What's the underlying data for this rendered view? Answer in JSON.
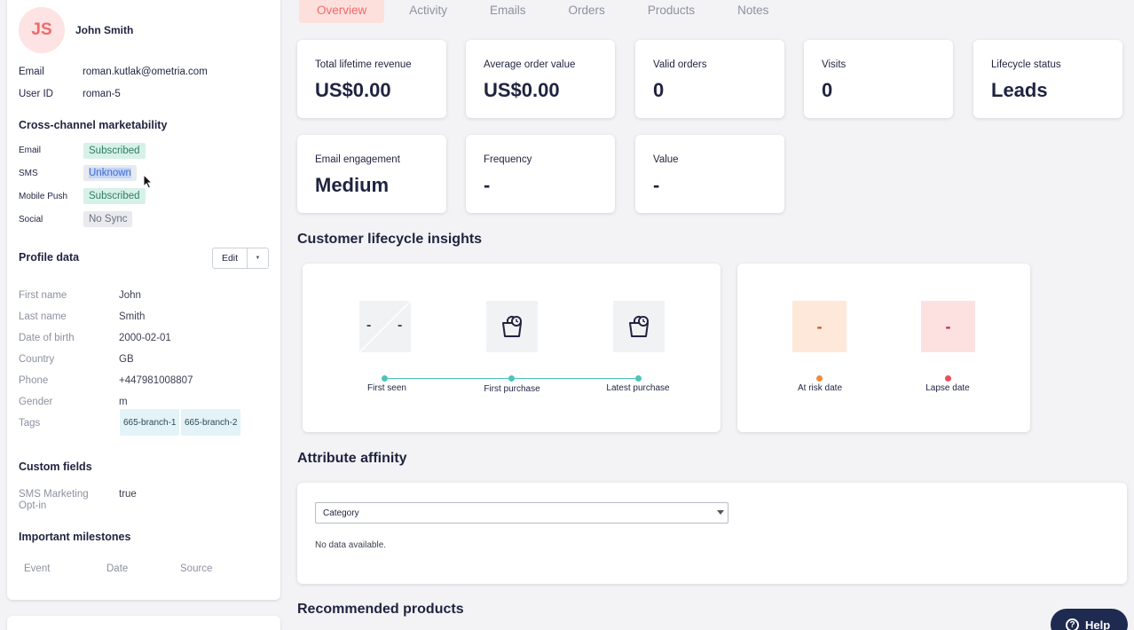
{
  "profile": {
    "initials": "JS",
    "name": "John Smith",
    "email_label": "Email",
    "email": "roman.kutlak@ometria.com",
    "userid_label": "User ID",
    "userid": "roman-5"
  },
  "marketability": {
    "title": "Cross-channel marketability",
    "channels": [
      {
        "label": "Email",
        "status": "Subscribed"
      },
      {
        "label": "SMS",
        "status": "Unknown"
      },
      {
        "label": "Mobile Push",
        "status": "Subscribed"
      },
      {
        "label": "Social",
        "status": "No Sync"
      }
    ]
  },
  "profile_data": {
    "title": "Profile data",
    "edit_label": "Edit",
    "fields": [
      {
        "label": "First name",
        "value": "John"
      },
      {
        "label": "Last name",
        "value": "Smith"
      },
      {
        "label": "Date of birth",
        "value": "2000-02-01"
      },
      {
        "label": "Country",
        "value": "GB"
      },
      {
        "label": "Phone",
        "value": "+447981008807"
      },
      {
        "label": "Gender",
        "value": "m"
      },
      {
        "label": "Tags",
        "value": ""
      }
    ],
    "tags": [
      "665-branch-1",
      "665-branch-2"
    ]
  },
  "custom_fields": {
    "title": "Custom fields",
    "items": [
      {
        "label": "SMS Marketing Opt-in",
        "value": "true"
      }
    ]
  },
  "milestones": {
    "title": "Important milestones",
    "columns": [
      "Event",
      "Date",
      "Source"
    ]
  },
  "tabs": [
    "Overview",
    "Activity",
    "Emails",
    "Orders",
    "Products",
    "Notes"
  ],
  "metrics": [
    {
      "label": "Total lifetime revenue",
      "value": "US$0.00"
    },
    {
      "label": "Average order value",
      "value": "US$0.00"
    },
    {
      "label": "Valid orders",
      "value": "0"
    },
    {
      "label": "Visits",
      "value": "0"
    },
    {
      "label": "Lifecycle status",
      "value": "Leads"
    },
    {
      "label": "Email engagement",
      "value": "Medium"
    },
    {
      "label": "Frequency",
      "value": "-"
    },
    {
      "label": "Value",
      "value": "-"
    }
  ],
  "lifecycle": {
    "title": "Customer lifecycle insights",
    "first_seen_value": "-",
    "first_seen_value2": "-",
    "timeline": [
      "First seen",
      "First purchase",
      "Latest purchase"
    ],
    "at_risk": {
      "label": "At risk date",
      "value": "-",
      "color": "#f08c3c"
    },
    "lapse": {
      "label": "Lapse date",
      "value": "-",
      "color": "#e8505b"
    }
  },
  "affinity": {
    "title": "Attribute affinity",
    "select_value": "Category",
    "empty": "No data available."
  },
  "recommended": {
    "title": "Recommended products"
  },
  "help_label": "Help"
}
